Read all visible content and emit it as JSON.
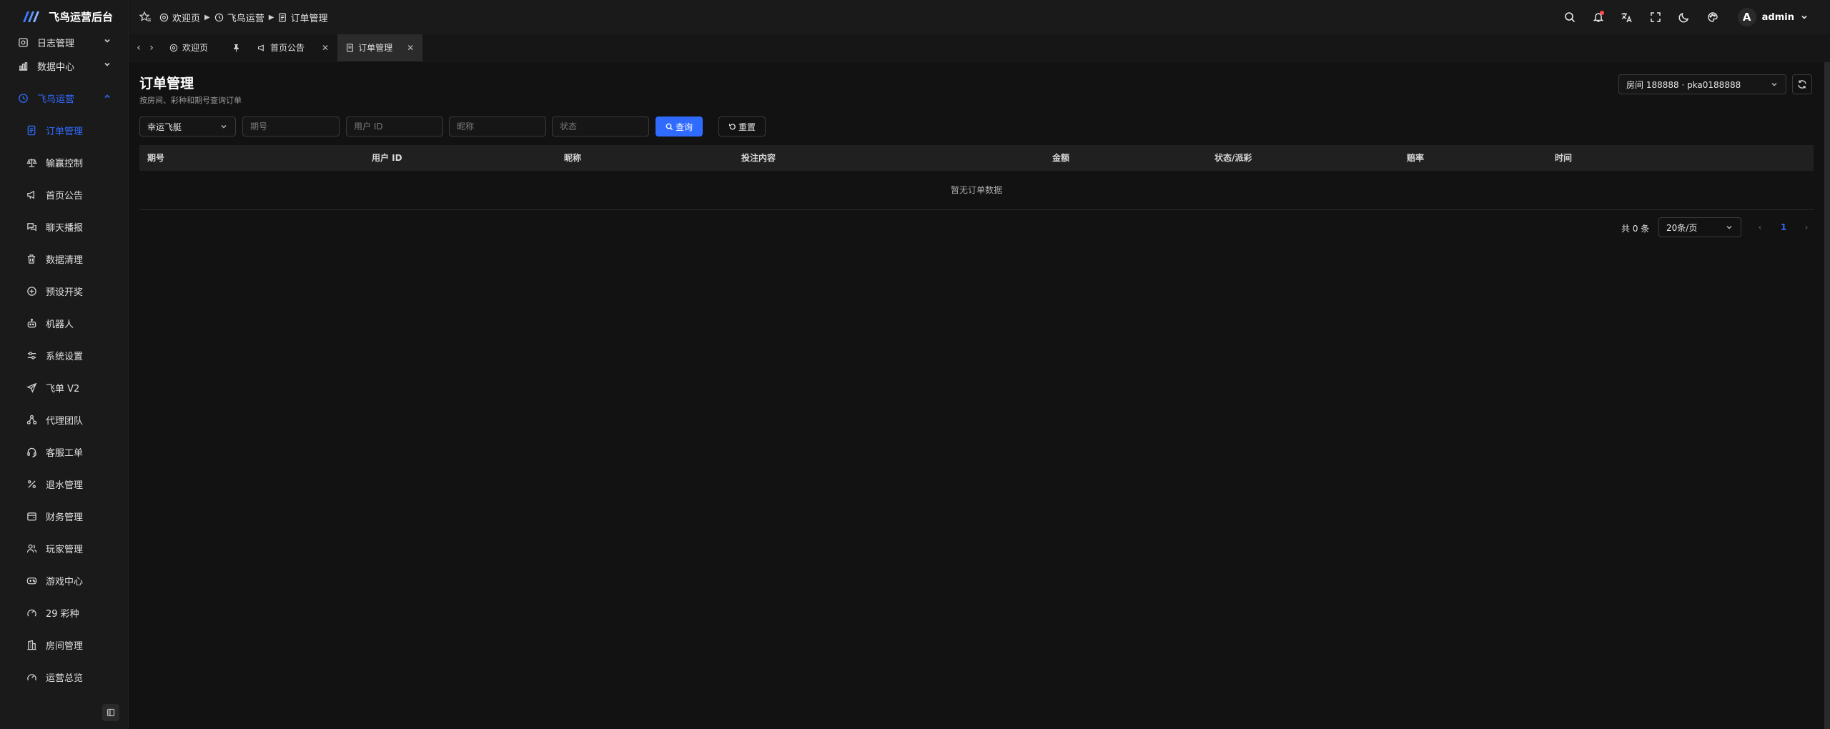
{
  "brand": {
    "title": "飞鸟运营后台"
  },
  "sidebar": {
    "items": [
      {
        "label": "日志管理",
        "icon": "log-icon"
      },
      {
        "label": "数据中心",
        "icon": "chart-icon"
      },
      {
        "label": "飞鸟运营",
        "icon": "clock-icon"
      },
      {
        "label": "订单管理",
        "icon": "document-icon"
      },
      {
        "label": "输赢控制",
        "icon": "scale-icon"
      },
      {
        "label": "首页公告",
        "icon": "megaphone-icon"
      },
      {
        "label": "聊天播报",
        "icon": "chat-icon"
      },
      {
        "label": "数据清理",
        "icon": "trash-icon"
      },
      {
        "label": "预设开奖",
        "icon": "plus-circle-icon"
      },
      {
        "label": "机器人",
        "icon": "robot-icon"
      },
      {
        "label": "系统设置",
        "icon": "sliders-icon"
      },
      {
        "label": "飞单 V2",
        "icon": "send-icon"
      },
      {
        "label": "代理团队",
        "icon": "team-icon"
      },
      {
        "label": "客服工单",
        "icon": "headset-icon"
      },
      {
        "label": "退水管理",
        "icon": "percent-icon"
      },
      {
        "label": "财务管理",
        "icon": "wallet-icon"
      },
      {
        "label": "玩家管理",
        "icon": "users-icon"
      },
      {
        "label": "游戏中心",
        "icon": "gamepad-icon"
      },
      {
        "label": "29 彩种",
        "icon": "lottery-icon"
      },
      {
        "label": "房间管理",
        "icon": "building-icon"
      },
      {
        "label": "运营总览",
        "icon": "gauge-icon"
      }
    ]
  },
  "breadcrumb": {
    "home": "欢迎页",
    "section": "飞鸟运营",
    "current": "订单管理"
  },
  "user": {
    "initial": "A",
    "name": "admin"
  },
  "tabs": [
    {
      "label": "欢迎页"
    },
    {
      "label": "首页公告"
    },
    {
      "label": "订单管理"
    }
  ],
  "page": {
    "title": "订单管理",
    "subtitle": "按房间、彩种和期号查询订单",
    "room_select": "房间 188888 · pka0188888"
  },
  "filters": {
    "lottery": "幸运飞艇",
    "period_placeholder": "期号",
    "userid_placeholder": "用户 ID",
    "nickname_placeholder": "昵称",
    "status_placeholder": "状态",
    "query_label": "查询",
    "reset_label": "重置"
  },
  "table": {
    "columns": [
      "期号",
      "用户 ID",
      "昵称",
      "投注内容",
      "金额",
      "状态/派彩",
      "赔率",
      "时间"
    ],
    "empty_text": "暂无订单数据"
  },
  "pagination": {
    "total": "共 0 条",
    "page_size": "20条/页",
    "current": "1"
  },
  "colors": {
    "accent": "#2f6bff",
    "background": "#121212",
    "sidebar": "#1a1a1a",
    "notification": "#ff4d4f"
  }
}
